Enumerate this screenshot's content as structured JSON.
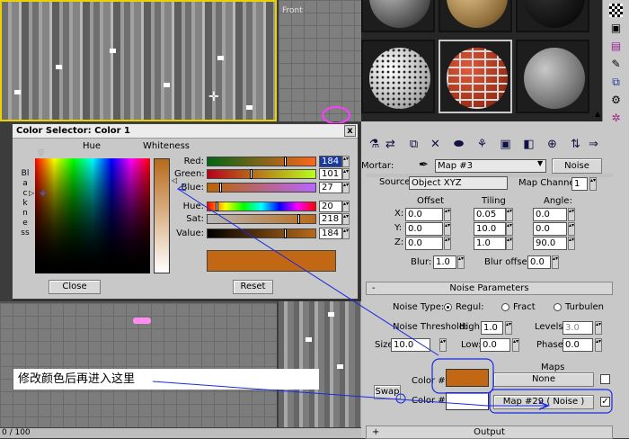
{
  "viewports": {
    "front_label": "Front",
    "frame_counter": "0 / 100"
  },
  "material_editor": {
    "mortar_label": "Mortar:",
    "map_name": "Map #3",
    "map_type": "Noise",
    "source_label": "Source:",
    "source_value": "Object XYZ",
    "map_channel_label": "Map Channel:",
    "map_channel_value": "1",
    "coords": {
      "offset_label": "Offset",
      "tiling_label": "Tiling",
      "angle_label": "Angle:",
      "rows": [
        {
          "axis": "X:",
          "offset": "0.0",
          "tiling": "0.05",
          "angle": "0.0"
        },
        {
          "axis": "Y:",
          "offset": "0.0",
          "tiling": "10.0",
          "angle": "0.0"
        },
        {
          "axis": "Z:",
          "offset": "0.0",
          "tiling": "1.0",
          "angle": "90.0"
        }
      ],
      "blur_label": "Blur:",
      "blur_value": "1.0",
      "blur_offset_label": "Blur offset:",
      "blur_offset_value": "0.0"
    },
    "noise_params": {
      "header": "Noise Parameters",
      "collapse_glyph": "-",
      "noise_type_label": "Noise Type:",
      "types": [
        "Regul:",
        "Fract",
        "Turbulen"
      ],
      "threshold_label": "Noise Threshold:",
      "high_label": "High:",
      "high_value": "1.0",
      "levels_label": "Levels:",
      "levels_value": "3.0",
      "size_label": "Size:",
      "size_value": "10.0",
      "low_label": "Low:",
      "low_value": "0.0",
      "phase_label": "Phase:",
      "phase_value": "0.0",
      "maps_label": "Maps",
      "color1_label": "Color #1",
      "color1_hex": "#c26714",
      "color1_map": "None",
      "swap_label": "Swap",
      "color2_label": "Color #2",
      "color2_hex": "#ffffff",
      "color2_map": "Map #29 ( Noise )"
    },
    "output_header": "Output",
    "output_glyph": "+"
  },
  "color_selector": {
    "title": "Color Selector: Color 1",
    "close_glyph": "x",
    "hue_label": "Hue",
    "whiteness_label": "Whiteness",
    "blackness_label": "Blackness",
    "sliders": [
      {
        "label": "Red:",
        "value": "184",
        "fraction": 0.72
      },
      {
        "label": "Green:",
        "value": "101",
        "fraction": 0.4
      },
      {
        "label": "Blue:",
        "value": "27",
        "fraction": 0.11
      },
      {
        "label": "Hue:",
        "value": "20",
        "fraction": 0.08
      },
      {
        "label": "Sat:",
        "value": "218",
        "fraction": 0.85
      },
      {
        "label": "Value:",
        "value": "184",
        "fraction": 0.72
      }
    ],
    "current_color": "#c26714",
    "close_button": "Close",
    "reset_button": "Reset"
  },
  "annotation": {
    "text": "修改颜色后再进入这里",
    "line_color": "#1a2ae0"
  }
}
